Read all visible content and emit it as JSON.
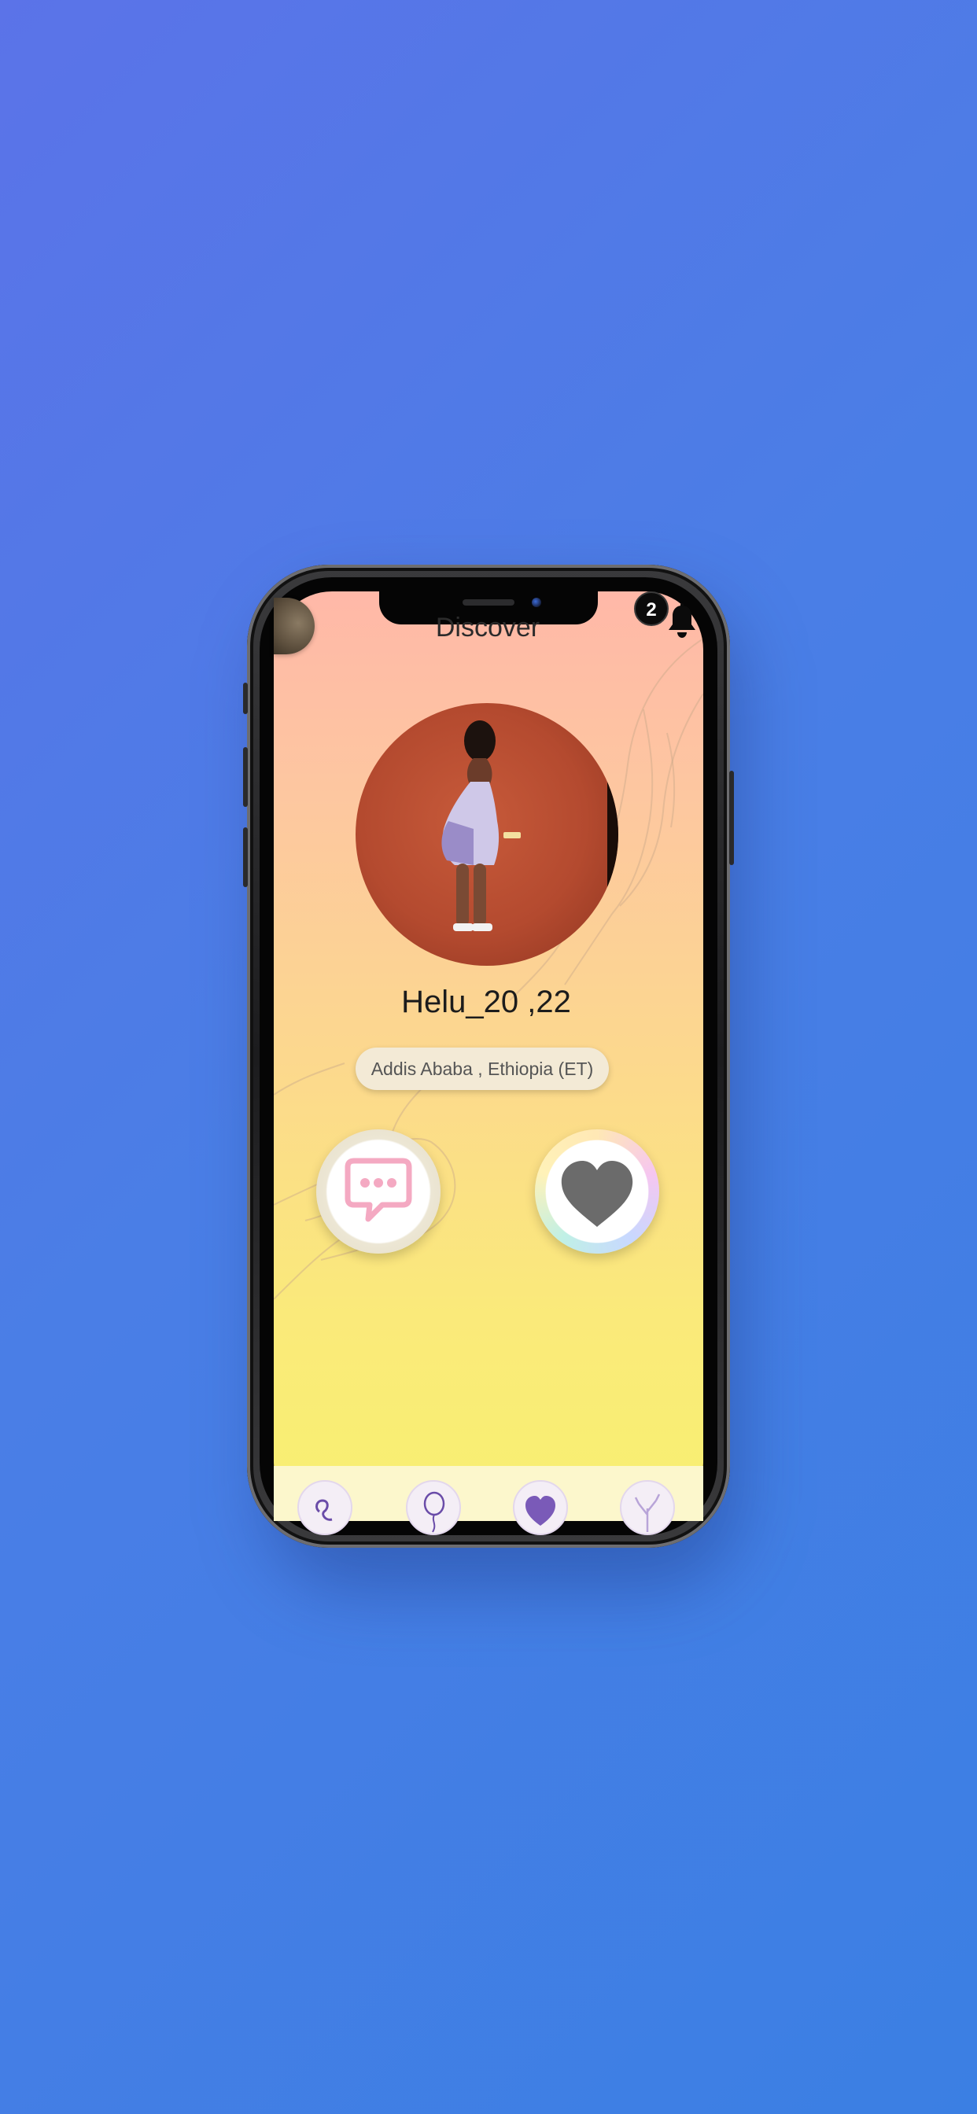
{
  "header": {
    "title": "Discover",
    "notification_count": "2"
  },
  "profile": {
    "name_age": "Helu_20 ,22",
    "location": "Addis Ababa , Ethiopia (ET)"
  },
  "actions": {
    "message_icon": "chat-bubble-icon",
    "like_icon": "heart-icon"
  },
  "bottom_nav": {
    "items": [
      {
        "icon": "swirl-icon"
      },
      {
        "icon": "balloon-icon"
      },
      {
        "icon": "fingerprint-heart-icon"
      },
      {
        "icon": "tree-icon"
      }
    ]
  },
  "colors": {
    "background_start": "#5b73e8",
    "background_end": "#3b7fe3",
    "screen_top": "#ffb8a8",
    "screen_bottom": "#f8f070",
    "heart": "#6b6b6b",
    "chat_icon": "#f4a9c2"
  }
}
